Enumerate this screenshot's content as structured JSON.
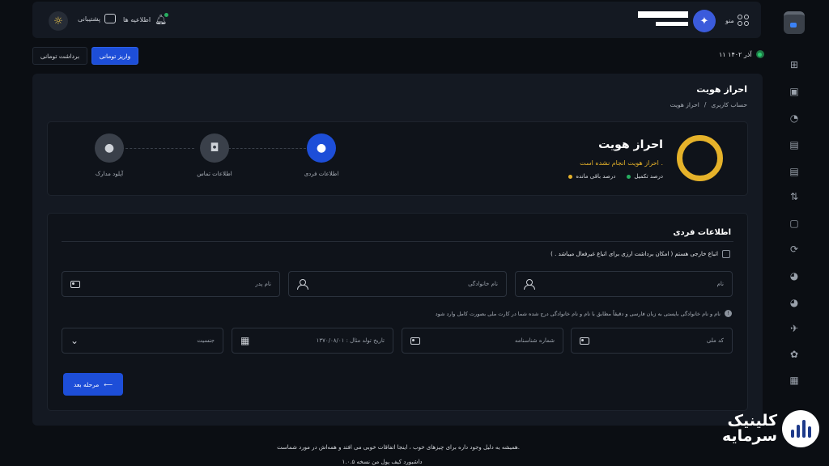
{
  "topbar": {
    "support_label": "پشتیبانی",
    "notifications_label": "اطلاعیه ها",
    "menu_label": "منو"
  },
  "date_label": "۱۱ آذر ۱۴۰۲",
  "actions": {
    "deposit_label": "واریز تومانی",
    "withdraw_label": "برداشت تومانی"
  },
  "page": {
    "title": "احراز هویت",
    "breadcrumb": [
      "حساب کاربری",
      "/",
      "احراز هویت"
    ]
  },
  "status": {
    "title": "احراز هویت",
    "warning": "احراز هویت انجام نشده است .",
    "legend_complete": "درصد تکمیل",
    "legend_remaining": "درصد باقی مانده",
    "complete_percent": 0,
    "colors": {
      "complete": "#27ae60",
      "remaining": "#e5b22a"
    }
  },
  "steps": [
    {
      "label": "اطلاعات فردی",
      "icon": "user-icon",
      "active": true
    },
    {
      "label": "اطلاعات تماس",
      "icon": "contact-icon",
      "active": false
    },
    {
      "label": "آپلود مدارک",
      "icon": "user-icon",
      "active": false
    }
  ],
  "form": {
    "title": "اطلاعات فردی",
    "foreign_checkbox_label": "اتباع خارجی هستم ( امکان برداشت ارزی برای اتباع غیرفعال میباشد . )",
    "first_name_placeholder": "نام",
    "last_name_placeholder": "نام خانوادگی",
    "father_name_placeholder": "نام پدر",
    "hint": "نام و نام خانوادگی بایستی به زبان فارسی و دقیقاً مطابق با نام و نام خانوادگی درج شده شما در کارت ملی بصورت کامل وارد شود",
    "national_code_placeholder": "کد ملی",
    "id_number_placeholder": "شماره شناسنامه",
    "birth_date_placeholder": "تاریخ تولد مثال : ۱۳۷۰/۰۸/۰۱",
    "gender_placeholder": "جنسیت",
    "next_label": "مرحله بعد"
  },
  "footer": {
    "line1": "همیشه یه دلیل وجود داره برای چیزهای خوب ، اینجا اتفاقات خوبی می افتد و همه‌اش در مورد شماست.",
    "line2": "داشبورد کیف پول من نسخه ۱.۰.۵"
  },
  "watermark": {
    "line1": "کلینیک",
    "line2": "سرمایه"
  }
}
